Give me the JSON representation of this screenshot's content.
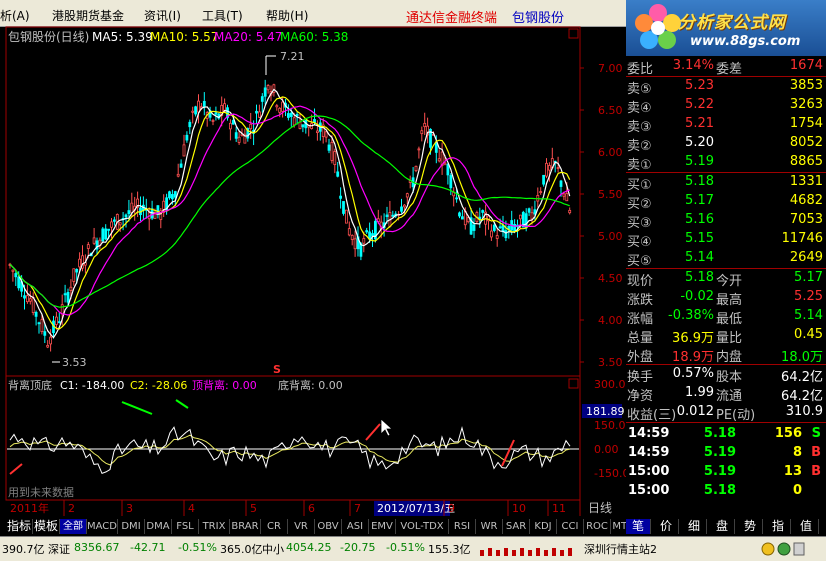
{
  "menu": {
    "items": [
      "析(A)",
      "港股期货基金",
      "资讯(I)",
      "工具(T)",
      "帮助(H)"
    ],
    "promo": "通达信金融终端",
    "stock_title": "包钢股份"
  },
  "logo": {
    "text": "分析家公式网",
    "url": "www.88gs.com"
  },
  "chart": {
    "header_name": "包钢股份(日线)",
    "ma5_label": "MA5: 5.39",
    "ma10_label": "MA10: 5.57",
    "ma20_label": "MA20: 5.47",
    "ma60_label": "MA60: 5.38",
    "price_ticks": [
      "7.00",
      "6.50",
      "6.00",
      "5.50",
      "5.00",
      "4.50",
      "4.00",
      "3.50"
    ],
    "high_label": "7.21",
    "low_label": "3.53",
    "indicator_name": "背离顶底",
    "c1_label": "C1: -184.00",
    "c2_label": "C2: -28.06",
    "top_div_label": "顶背离: 0.00",
    "bottom_div_label": "底背离: 0.00",
    "ind_ticks": [
      "300.00",
      "181.89",
      "150.00",
      "0.00",
      "-150.00"
    ],
    "watermark": "用到未来数据",
    "date_axis": [
      "2011年",
      "2",
      "3",
      "4",
      "5",
      "6",
      "7",
      "2012/07/13/五",
      "9",
      "10",
      "11"
    ],
    "period": "日线",
    "colors": {
      "up": "#ff5050",
      "down": "#00ffff",
      "ma5": "#ffffff",
      "ma10": "#ffff00",
      "ma20": "#ff00ff",
      "ma60": "#00ff00"
    }
  },
  "quote": {
    "webi_label": "委比",
    "webi_value": "3.14%",
    "weicha_label": "委差",
    "weicha_value": "1674",
    "sell": [
      {
        "label": "卖⑤",
        "price": "5.23",
        "vol": "3853"
      },
      {
        "label": "卖④",
        "price": "5.22",
        "vol": "3263"
      },
      {
        "label": "卖③",
        "price": "5.21",
        "vol": "1754"
      },
      {
        "label": "卖②",
        "price": "5.20",
        "vol": "8052"
      },
      {
        "label": "卖①",
        "price": "5.19",
        "vol": "8865"
      }
    ],
    "buy": [
      {
        "label": "买①",
        "price": "5.18",
        "vol": "1331"
      },
      {
        "label": "买②",
        "price": "5.17",
        "vol": "4682"
      },
      {
        "label": "买③",
        "price": "5.16",
        "vol": "7053"
      },
      {
        "label": "买④",
        "price": "5.15",
        "vol": "11746"
      },
      {
        "label": "买⑤",
        "price": "5.14",
        "vol": "2649"
      }
    ],
    "stats": [
      {
        "l1": "现价",
        "v1": "5.18",
        "l2": "今开",
        "v2": "5.17"
      },
      {
        "l1": "涨跌",
        "v1": "-0.02",
        "l2": "最高",
        "v2": "5.25"
      },
      {
        "l1": "涨幅",
        "v1": "-0.38%",
        "l2": "最低",
        "v2": "5.14"
      },
      {
        "l1": "总量",
        "v1": "36.9万",
        "l2": "量比",
        "v2": "0.45"
      },
      {
        "l1": "外盘",
        "v1": "18.9万",
        "l2": "内盘",
        "v2": "18.0万"
      }
    ],
    "stats2": [
      {
        "l1": "换手",
        "v1": "0.57%",
        "l2": "股本",
        "v2": "64.2亿"
      },
      {
        "l1": "净资",
        "v1": "1.99",
        "l2": "流通",
        "v2": "64.2亿"
      },
      {
        "l1": "收益(三)",
        "v1": "0.012",
        "l2": "PE(动)",
        "v2": "310.9"
      }
    ],
    "ticks": [
      {
        "time": "14:59",
        "price": "5.18",
        "vol": "156",
        "flag": "S"
      },
      {
        "time": "14:59",
        "price": "5.19",
        "vol": "8",
        "flag": "B"
      },
      {
        "time": "15:00",
        "price": "5.19",
        "vol": "13",
        "flag": "B"
      },
      {
        "time": "15:00",
        "price": "5.18",
        "vol": "0",
        "flag": ""
      }
    ]
  },
  "tabs": [
    "指标",
    "模板",
    "全部",
    "MACD",
    "DMI",
    "DMA",
    "FSL",
    "TRIX",
    "BRAR",
    "CR",
    "VR",
    "OBV",
    "ASI",
    "EMV",
    "VOL-TDX",
    "RSI",
    "WR",
    "SAR",
    "KDJ",
    "CCI",
    "ROC",
    "MTM"
  ],
  "right_tabs": [
    "笔",
    "价",
    "细",
    "盘",
    "势",
    "指",
    "值"
  ],
  "status": {
    "vol_left": "390.7亿",
    "sz_name": "深证",
    "sz_index": "8356.67",
    "sz_change": "-42.71",
    "sz_pct": "-0.51%",
    "sz_amount": "365.0亿",
    "zx_name": "中小",
    "zx_index": "4054.25",
    "zx_change": "-20.75",
    "zx_pct": "-0.51%",
    "zx_amount": "155.3亿",
    "server": "深圳行情主站2"
  }
}
